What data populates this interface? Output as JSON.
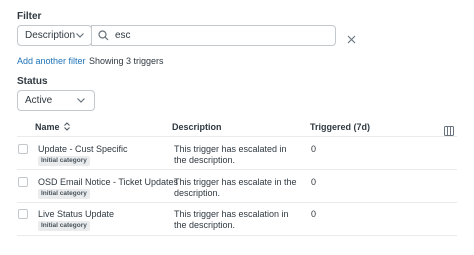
{
  "filter": {
    "label": "Filter",
    "field_select": "Description",
    "search_value": "esc",
    "add_filter_link": "Add another filter",
    "result_count": "Showing 3 triggers"
  },
  "status": {
    "label": "Status",
    "selected": "Active"
  },
  "table": {
    "columns": {
      "name": "Name",
      "description": "Description",
      "triggered": "Triggered (7d)"
    },
    "rows": [
      {
        "name": "Update - Cust Specific",
        "category": "Initial category",
        "description": "This trigger has escalated in the description.",
        "triggered": "0"
      },
      {
        "name": "OSD Email Notice - Ticket Updates",
        "category": "Initial category",
        "description": "This trigger has escalate in the description.",
        "triggered": "0"
      },
      {
        "name": "Live Status Update",
        "category": "Initial category",
        "description": "This trigger has escalation in the description.",
        "triggered": "0"
      }
    ]
  },
  "icons": {
    "dropdown": "chevron-down-icon",
    "search": "search-icon",
    "clear": "close-icon",
    "sort": "sort-icon",
    "columns": "columns-icon"
  }
}
